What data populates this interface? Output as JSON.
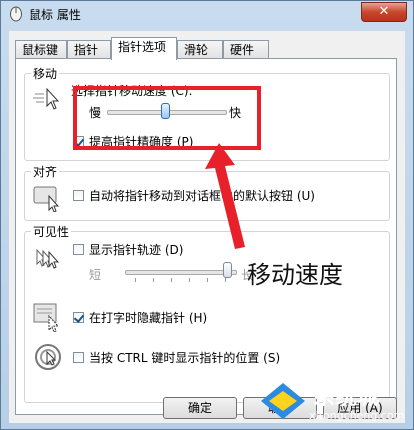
{
  "window": {
    "title": "鼠标 属性",
    "close_label": "✕"
  },
  "tabs": [
    {
      "label": "鼠标键"
    },
    {
      "label": "指针"
    },
    {
      "label": "指针选项"
    },
    {
      "label": "滑轮"
    },
    {
      "label": "硬件"
    }
  ],
  "motion": {
    "group_label": "移动",
    "speed_label": "选择指针移动速度 (C):",
    "slow_label": "慢",
    "fast_label": "快",
    "speed_level": 0.5,
    "precision_label": "提高指针精确度 (P)",
    "precision_checked": true
  },
  "snap": {
    "group_label": "对齐",
    "snap_label": "自动将指针移动到对话框中的默认按钮 (U)",
    "snap_checked": false
  },
  "visibility": {
    "group_label": "可见性",
    "trails_label": "显示指针轨迹 (D)",
    "trails_checked": false,
    "short_label": "短",
    "long_label": "长",
    "hide_label": "在打字时隐藏指针 (H)",
    "hide_checked": true,
    "ctrl_label": "当按 CTRL 键时显示指针的位置 (S)",
    "ctrl_checked": false
  },
  "annotation": {
    "text": "移动速度",
    "color": "#e8202a"
  },
  "buttons": {
    "ok": "确定",
    "cancel": "取消",
    "apply": "应用 (A)"
  },
  "watermark": {
    "brand": "系统城",
    "url": "xitongcheng.com"
  }
}
